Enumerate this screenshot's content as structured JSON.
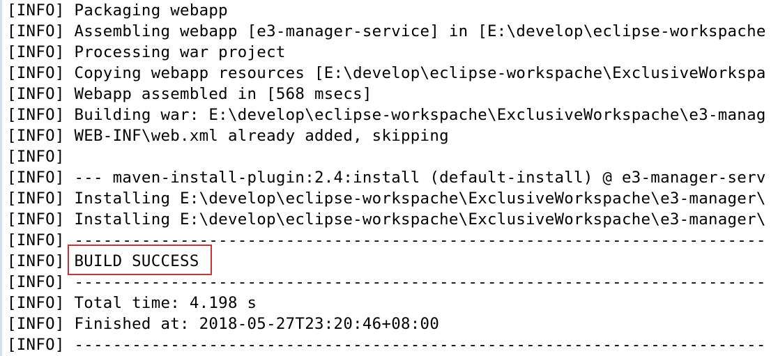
{
  "console": {
    "level_tag": "[INFO]",
    "lines": [
      "Packaging webapp",
      "Assembling webapp [e3-manager-service] in [E:\\develop\\eclipse-workspache",
      "Processing war project",
      "Copying webapp resources [E:\\develop\\eclipse-workspache\\ExclusiveWorkspa",
      "Webapp assembled in [568 msecs]",
      "Building war: E:\\develop\\eclipse-workspache\\ExclusiveWorkspache\\e3-manag",
      "WEB-INF\\web.xml already added, skipping",
      "",
      "--- maven-install-plugin:2.4:install (default-install) @ e3-manager-serv",
      "Installing E:\\develop\\eclipse-workspache\\ExclusiveWorkspache\\e3-manager\\",
      "Installing E:\\develop\\eclipse-workspache\\ExclusiveWorkspache\\e3-manager\\",
      "------------------------------------------------------------------------",
      "BUILD SUCCESS",
      "------------------------------------------------------------------------",
      "Total time: 4.198 s",
      "Finished at: 2018-05-27T23:20:46+08:00",
      "------------------------------------------------------------------------"
    ],
    "highlighted_line_index": 12
  },
  "colors": {
    "highlight_border": "#c8323c",
    "text": "#000000",
    "background": "#ffffff"
  }
}
